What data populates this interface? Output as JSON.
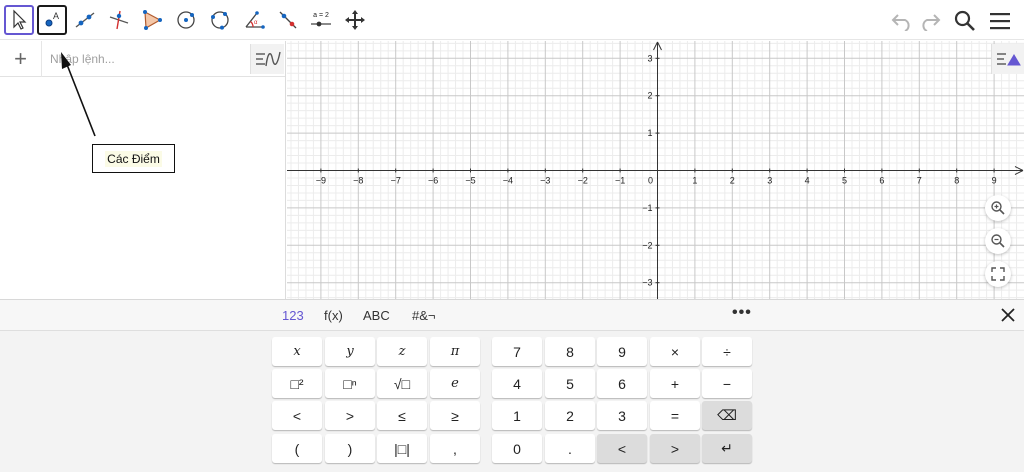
{
  "algebra": {
    "add_label": "+",
    "input_placeholder": "Nhập lệnh..."
  },
  "tooltip": {
    "text": "Các Điểm"
  },
  "graphics": {
    "x_ticks": [
      "−9",
      "−8",
      "−7",
      "−6",
      "−5",
      "−4",
      "−3",
      "−2",
      "−1",
      "0",
      "1",
      "2",
      "3",
      "4",
      "5",
      "6",
      "7",
      "8",
      "9"
    ],
    "x_values": [
      -9,
      -8,
      -7,
      -6,
      -5,
      -4,
      -3,
      -2,
      -1,
      0,
      1,
      2,
      3,
      4,
      5,
      6,
      7,
      8,
      9
    ],
    "y_ticks": [
      "3",
      "2",
      "1",
      "−1",
      "−2",
      "−3"
    ],
    "y_values": [
      3,
      2,
      1,
      -1,
      -2,
      -3
    ],
    "grid": true
  },
  "toolbar": {
    "tools": [
      "move-tool",
      "point-tool",
      "line-tool",
      "perpendicular-line-tool",
      "polygon-tool",
      "circle-center-point-tool",
      "circle-three-points-tool",
      "angle-tool",
      "reflect-tool",
      "slider-tool",
      "move-graphics-view-tool"
    ],
    "slider_label": "a = 2"
  },
  "keyboard": {
    "tabs": [
      "123",
      "f(x)",
      "ABC",
      "#&¬"
    ],
    "more": "•••",
    "rows": [
      [
        "x",
        "y",
        "z",
        "π"
      ],
      [
        "□²",
        "□ⁿ",
        "√□",
        "e"
      ],
      [
        "<",
        ">",
        "≤",
        "≥"
      ],
      [
        "(",
        ")",
        "|□|",
        ","
      ]
    ],
    "num_rows": [
      [
        "7",
        "8",
        "9",
        "×",
        "÷"
      ],
      [
        "4",
        "5",
        "6",
        "+",
        "−"
      ],
      [
        "1",
        "2",
        "3",
        "=",
        "⌫"
      ],
      [
        "0",
        ".",
        "<",
        ">",
        "↵"
      ]
    ]
  },
  "colors": {
    "accent": "#6557d2",
    "point": "#1565c0",
    "tool_red": "#d32f2f"
  }
}
